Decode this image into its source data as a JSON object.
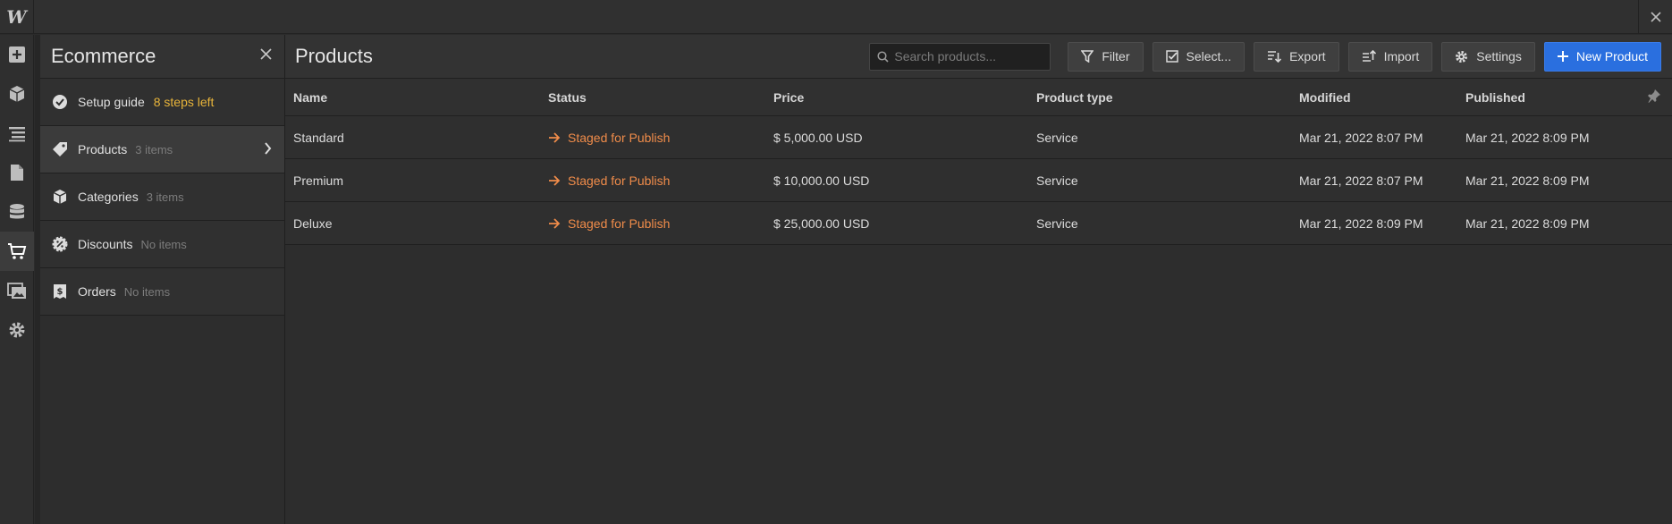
{
  "app": {
    "logo": "W"
  },
  "rail": {
    "icons": [
      "add-panel-icon",
      "components-icon",
      "navigator-icon",
      "pages-icon",
      "cms-icon",
      "ecommerce-icon",
      "assets-icon",
      "settings-icon"
    ]
  },
  "panel": {
    "title": "Ecommerce",
    "items": [
      {
        "label": "Setup guide",
        "count": "8 steps left",
        "icon": "check-circle-icon"
      },
      {
        "label": "Products",
        "count": "3 items",
        "icon": "tag-icon"
      },
      {
        "label": "Categories",
        "count": "3 items",
        "icon": "box-icon"
      },
      {
        "label": "Discounts",
        "count": "No items",
        "icon": "discount-icon"
      },
      {
        "label": "Orders",
        "count": "No items",
        "icon": "receipt-icon"
      }
    ]
  },
  "main": {
    "title": "Products",
    "search": {
      "placeholder": "Search products..."
    },
    "toolbar": {
      "filter": "Filter",
      "select": "Select...",
      "export": "Export",
      "import": "Import",
      "settings": "Settings",
      "new_product": "New Product"
    },
    "table": {
      "headers": [
        "Name",
        "Status",
        "Price",
        "Product type",
        "Modified",
        "Published"
      ],
      "rows": [
        {
          "name": "Standard",
          "status": "Staged for Publish",
          "price": "$ 5,000.00 USD",
          "type": "Service",
          "modified": "Mar 21, 2022 8:07 PM",
          "published": "Mar 21, 2022 8:09 PM"
        },
        {
          "name": "Premium",
          "status": "Staged for Publish",
          "price": "$ 10,000.00 USD",
          "type": "Service",
          "modified": "Mar 21, 2022 8:07 PM",
          "published": "Mar 21, 2022 8:09 PM"
        },
        {
          "name": "Deluxe",
          "status": "Staged for Publish",
          "price": "$ 25,000.00 USD",
          "type": "Service",
          "modified": "Mar 21, 2022 8:09 PM",
          "published": "Mar 21, 2022 8:09 PM"
        }
      ]
    }
  },
  "colors": {
    "accent": "#2a6fdf",
    "status": "#f08c4a",
    "setup": "#e8b43a"
  }
}
